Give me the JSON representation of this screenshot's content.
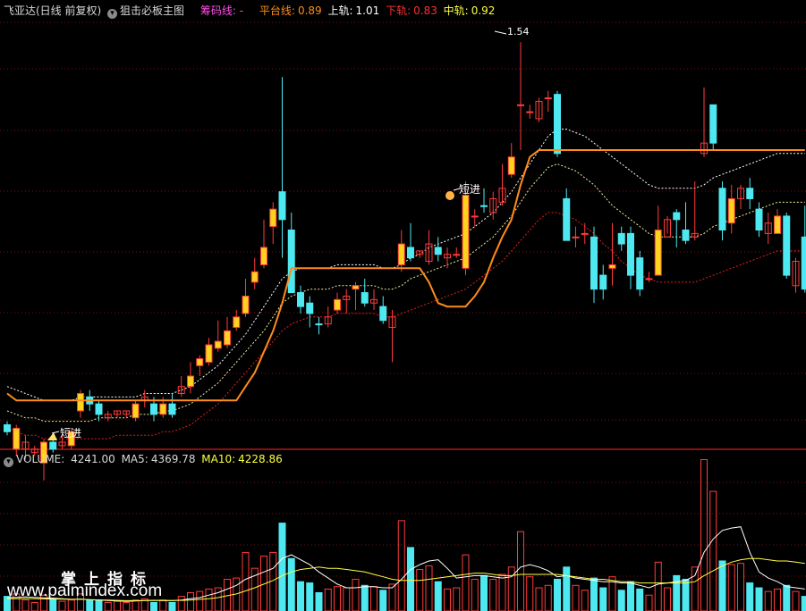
{
  "main_legend": {
    "stock_name": "飞亚达(日线 前复权)",
    "template_name": "狙击必板主图",
    "chip_label": "筹码线: -",
    "platform_label": "平台线:",
    "platform_value": "0.89",
    "upper_label": "上轨:",
    "upper_value": "1.01",
    "lower_label": "下轨:",
    "lower_value": "0.83",
    "middle_label": "中轨:",
    "middle_value": "0.92"
  },
  "volume_legend": {
    "volume_label": "VOLUME:",
    "volume_value": "4241.00",
    "ma5_label": "MA5:",
    "ma5_value": "4369.78",
    "ma10_label": "MA10:",
    "ma10_value": "4228.86"
  },
  "annotations": {
    "signal_1": "短进",
    "signal_2": "短进",
    "high_label": "1.54"
  },
  "watermark": {
    "cn": "掌上指标",
    "url": "www.palmindex.com"
  },
  "colors": {
    "up": "#ff3b3b",
    "down": "#4ee8f0",
    "yellow_body": "#ffd21e",
    "platform": "#ff8c1a",
    "upper": "#ffffff",
    "middle": "#f2ef9a",
    "lower": "#e02020",
    "grid": "#7a1010",
    "ma5": "#ffffff",
    "ma10": "#ffff40"
  },
  "chart_data": {
    "type": "candlestick",
    "price_range": [
      0.36,
      1.58
    ],
    "candles": [
      [
        0.41,
        0.39,
        0.42,
        0.38,
        "d"
      ],
      [
        0.4,
        0.34,
        0.41,
        0.32,
        "y"
      ],
      [
        0.34,
        0.36,
        0.38,
        0.31,
        "u"
      ],
      [
        0.33,
        0.34,
        0.35,
        0.32,
        "u"
      ],
      [
        0.3,
        0.36,
        0.37,
        0.25,
        "y"
      ],
      [
        0.36,
        0.34,
        0.37,
        0.33,
        "d"
      ],
      [
        0.35,
        0.36,
        0.38,
        0.34,
        "u"
      ],
      [
        0.35,
        0.39,
        0.4,
        0.34,
        "y"
      ],
      [
        0.45,
        0.5,
        0.51,
        0.43,
        "y"
      ],
      [
        0.49,
        0.47,
        0.51,
        0.45,
        "d"
      ],
      [
        0.47,
        0.44,
        0.48,
        0.42,
        "d"
      ],
      [
        0.43,
        0.44,
        0.45,
        0.42,
        "u"
      ],
      [
        0.44,
        0.45,
        0.45,
        0.43,
        "u"
      ],
      [
        0.45,
        0.44,
        0.45,
        0.43,
        "u"
      ],
      [
        0.43,
        0.47,
        0.48,
        0.42,
        "y"
      ],
      [
        0.48,
        0.49,
        0.51,
        0.46,
        "u"
      ],
      [
        0.47,
        0.44,
        0.49,
        0.42,
        "d"
      ],
      [
        0.44,
        0.47,
        0.49,
        0.43,
        "y"
      ],
      [
        0.47,
        0.44,
        0.5,
        0.43,
        "d"
      ],
      [
        0.5,
        0.52,
        0.55,
        0.49,
        "u"
      ],
      [
        0.52,
        0.55,
        0.59,
        0.5,
        "y"
      ],
      [
        0.58,
        0.6,
        0.61,
        0.55,
        "y"
      ],
      [
        0.59,
        0.64,
        0.66,
        0.58,
        "y"
      ],
      [
        0.63,
        0.65,
        0.71,
        0.62,
        "y"
      ],
      [
        0.64,
        0.68,
        0.72,
        0.63,
        "y"
      ],
      [
        0.69,
        0.72,
        0.74,
        0.68,
        "y"
      ],
      [
        0.73,
        0.78,
        0.83,
        0.72,
        "y"
      ],
      [
        0.82,
        0.85,
        0.89,
        0.8,
        "y"
      ],
      [
        0.87,
        0.92,
        1.0,
        0.86,
        "y"
      ],
      [
        0.98,
        1.03,
        1.05,
        0.93,
        "y"
      ],
      [
        1.08,
        1.0,
        1.41,
        0.89,
        "d"
      ],
      [
        0.97,
        0.79,
        1.02,
        0.79,
        "d"
      ],
      [
        0.79,
        0.75,
        0.81,
        0.73,
        "d"
      ],
      [
        0.76,
        0.73,
        0.78,
        0.69,
        "d"
      ],
      [
        0.7,
        0.7,
        0.72,
        0.67,
        "d"
      ],
      [
        0.72,
        0.7,
        0.75,
        0.69,
        "u"
      ],
      [
        0.74,
        0.77,
        0.79,
        0.73,
        "y"
      ],
      [
        0.77,
        0.78,
        0.8,
        0.73,
        "u"
      ],
      [
        0.8,
        0.81,
        0.82,
        0.74,
        "y"
      ],
      [
        0.79,
        0.76,
        0.83,
        0.75,
        "d"
      ],
      [
        0.76,
        0.77,
        0.8,
        0.74,
        "u"
      ],
      [
        0.75,
        0.71,
        0.78,
        0.7,
        "d"
      ],
      [
        0.69,
        0.72,
        0.74,
        0.59,
        "u"
      ],
      [
        0.87,
        0.93,
        0.97,
        0.85,
        "y"
      ],
      [
        0.92,
        0.89,
        0.99,
        0.88,
        "d"
      ],
      [
        0.9,
        0.91,
        0.91,
        0.89,
        "u"
      ],
      [
        0.88,
        0.93,
        0.97,
        0.87,
        "u"
      ],
      [
        0.92,
        0.9,
        0.95,
        0.88,
        "d"
      ],
      [
        0.89,
        0.9,
        0.92,
        0.86,
        "u"
      ],
      [
        0.9,
        0.9,
        0.92,
        0.89,
        "u"
      ],
      [
        0.86,
        1.07,
        1.11,
        0.84,
        "y"
      ],
      [
        1.01,
        1.01,
        1.03,
        0.98,
        "u"
      ],
      [
        1.04,
        1.04,
        1.09,
        1.02,
        "d"
      ],
      [
        1.02,
        1.06,
        1.08,
        1.0,
        "u"
      ],
      [
        1.05,
        1.09,
        1.16,
        1.04,
        "u"
      ],
      [
        1.13,
        1.18,
        1.22,
        1.12,
        "y"
      ],
      [
        1.33,
        1.33,
        1.51,
        1.2,
        "u"
      ],
      [
        1.31,
        1.31,
        1.33,
        1.29,
        "u"
      ],
      [
        1.29,
        1.34,
        1.35,
        1.28,
        "u"
      ],
      [
        1.35,
        1.35,
        1.37,
        1.31,
        "u"
      ],
      [
        1.36,
        1.19,
        1.37,
        1.18,
        "d"
      ],
      [
        1.06,
        0.94,
        1.09,
        0.94,
        "d"
      ],
      [
        0.95,
        0.95,
        0.98,
        0.92,
        "u"
      ],
      [
        0.96,
        0.96,
        0.99,
        0.93,
        "u"
      ],
      [
        0.95,
        0.8,
        0.98,
        0.76,
        "d"
      ],
      [
        0.8,
        0.84,
        0.87,
        0.77,
        "d"
      ],
      [
        0.86,
        0.87,
        0.99,
        0.81,
        "y"
      ],
      [
        0.93,
        0.96,
        0.98,
        0.91,
        "d"
      ],
      [
        0.96,
        0.84,
        0.98,
        0.8,
        "d"
      ],
      [
        0.89,
        0.8,
        0.91,
        0.78,
        "d"
      ],
      [
        0.83,
        0.83,
        0.85,
        0.82,
        "u"
      ],
      [
        0.84,
        0.97,
        1.04,
        0.84,
        "y"
      ],
      [
        0.95,
        1.0,
        1.01,
        0.96,
        "u"
      ],
      [
        1.02,
        1.0,
        1.03,
        0.92,
        "d"
      ],
      [
        0.97,
        0.94,
        1.05,
        0.93,
        "d"
      ],
      [
        0.95,
        0.96,
        1.11,
        0.94,
        "u"
      ],
      [
        1.19,
        1.22,
        1.38,
        1.18,
        "u"
      ],
      [
        1.33,
        1.22,
        1.33,
        1.2,
        "d"
      ],
      [
        1.09,
        0.97,
        1.11,
        0.94,
        "d"
      ],
      [
        0.99,
        1.06,
        1.1,
        0.96,
        "y"
      ],
      [
        1.06,
        1.09,
        1.1,
        1.03,
        "u"
      ],
      [
        1.09,
        1.06,
        1.12,
        1.03,
        "d"
      ],
      [
        1.03,
        0.97,
        1.05,
        0.95,
        "d"
      ],
      [
        0.96,
        0.99,
        1.02,
        0.93,
        "u"
      ],
      [
        1.01,
        0.96,
        1.03,
        0.96,
        "y"
      ],
      [
        1.01,
        0.84,
        1.02,
        0.83,
        "d"
      ],
      [
        0.88,
        0.81,
        0.89,
        0.79,
        "u"
      ],
      [
        0.95,
        0.8,
        1.04,
        0.79,
        "d"
      ]
    ],
    "platform": [
      0.5,
      0.48,
      0.48,
      0.48,
      0.48,
      0.48,
      0.48,
      0.48,
      0.48,
      0.48,
      0.48,
      0.48,
      0.48,
      0.48,
      0.48,
      0.48,
      0.48,
      0.48,
      0.48,
      0.48,
      0.48,
      0.48,
      0.48,
      0.48,
      0.48,
      0.48,
      0.52,
      0.56,
      0.62,
      0.68,
      0.76,
      0.86,
      0.86,
      0.86,
      0.86,
      0.86,
      0.86,
      0.86,
      0.86,
      0.86,
      0.86,
      0.86,
      0.86,
      0.86,
      0.86,
      0.86,
      0.82,
      0.76,
      0.75,
      0.75,
      0.75,
      0.78,
      0.82,
      0.89,
      0.95,
      1.0,
      1.1,
      1.18,
      1.2,
      1.2,
      1.2,
      1.2,
      1.2,
      1.2,
      1.2,
      1.2,
      1.2,
      1.2,
      1.2,
      1.2,
      1.2,
      1.2,
      1.2,
      1.2,
      1.2,
      1.2,
      1.2,
      1.2,
      1.2,
      1.2,
      1.2,
      1.2,
      1.2,
      1.2,
      1.2,
      1.2,
      1.2,
      1.2
    ],
    "upper": [
      0.52,
      0.51,
      0.5,
      0.49,
      0.48,
      0.48,
      0.48,
      0.48,
      0.49,
      0.49,
      0.49,
      0.49,
      0.49,
      0.49,
      0.49,
      0.5,
      0.5,
      0.5,
      0.5,
      0.51,
      0.52,
      0.54,
      0.56,
      0.58,
      0.61,
      0.64,
      0.67,
      0.71,
      0.75,
      0.79,
      0.83,
      0.85,
      0.86,
      0.86,
      0.86,
      0.86,
      0.87,
      0.87,
      0.87,
      0.87,
      0.87,
      0.86,
      0.86,
      0.87,
      0.89,
      0.9,
      0.92,
      0.93,
      0.94,
      0.95,
      0.96,
      0.98,
      1.0,
      1.02,
      1.05,
      1.08,
      1.12,
      1.16,
      1.2,
      1.24,
      1.26,
      1.26,
      1.25,
      1.24,
      1.22,
      1.2,
      1.18,
      1.16,
      1.14,
      1.12,
      1.1,
      1.09,
      1.09,
      1.09,
      1.09,
      1.09,
      1.1,
      1.12,
      1.13,
      1.14,
      1.15,
      1.16,
      1.17,
      1.18,
      1.19,
      1.19,
      1.19,
      1.19
    ],
    "middle": [
      0.45,
      0.44,
      0.43,
      0.43,
      0.42,
      0.42,
      0.42,
      0.42,
      0.42,
      0.42,
      0.43,
      0.43,
      0.43,
      0.43,
      0.44,
      0.44,
      0.44,
      0.45,
      0.45,
      0.46,
      0.47,
      0.49,
      0.51,
      0.53,
      0.56,
      0.59,
      0.62,
      0.65,
      0.68,
      0.72,
      0.76,
      0.78,
      0.79,
      0.8,
      0.8,
      0.8,
      0.81,
      0.81,
      0.81,
      0.81,
      0.81,
      0.8,
      0.8,
      0.81,
      0.83,
      0.84,
      0.85,
      0.86,
      0.87,
      0.88,
      0.89,
      0.91,
      0.93,
      0.95,
      0.98,
      1.01,
      1.05,
      1.09,
      1.12,
      1.15,
      1.16,
      1.15,
      1.14,
      1.12,
      1.1,
      1.07,
      1.04,
      1.02,
      1.0,
      0.98,
      0.96,
      0.95,
      0.95,
      0.95,
      0.95,
      0.95,
      0.96,
      0.98,
      0.99,
      1.0,
      1.01,
      1.02,
      1.03,
      1.04,
      1.05,
      1.05,
      1.05,
      1.05
    ],
    "lower": [
      0.4,
      0.39,
      0.38,
      0.38,
      0.37,
      0.37,
      0.37,
      0.37,
      0.37,
      0.37,
      0.37,
      0.37,
      0.38,
      0.38,
      0.38,
      0.38,
      0.38,
      0.39,
      0.39,
      0.4,
      0.41,
      0.43,
      0.45,
      0.47,
      0.5,
      0.53,
      0.56,
      0.59,
      0.62,
      0.65,
      0.68,
      0.7,
      0.71,
      0.72,
      0.72,
      0.72,
      0.73,
      0.73,
      0.73,
      0.73,
      0.73,
      0.72,
      0.72,
      0.73,
      0.74,
      0.75,
      0.76,
      0.77,
      0.78,
      0.79,
      0.8,
      0.82,
      0.84,
      0.86,
      0.88,
      0.91,
      0.94,
      0.97,
      1.0,
      1.02,
      1.02,
      1.01,
      1.0,
      0.98,
      0.96,
      0.93,
      0.91,
      0.88,
      0.86,
      0.84,
      0.83,
      0.82,
      0.82,
      0.82,
      0.82,
      0.82,
      0.83,
      0.84,
      0.85,
      0.86,
      0.87,
      0.88,
      0.89,
      0.9,
      0.91,
      0.91,
      0.91,
      0.91
    ],
    "volume_max": 12000,
    "volume": [
      [
        1200,
        "d"
      ],
      [
        1400,
        "u"
      ],
      [
        900,
        "u"
      ],
      [
        700,
        "u"
      ],
      [
        1300,
        "u"
      ],
      [
        1000,
        "d"
      ],
      [
        800,
        "u"
      ],
      [
        900,
        "u"
      ],
      [
        1400,
        "u"
      ],
      [
        900,
        "d"
      ],
      [
        900,
        "d"
      ],
      [
        700,
        "u"
      ],
      [
        800,
        "u"
      ],
      [
        700,
        "u"
      ],
      [
        900,
        "u"
      ],
      [
        1000,
        "u"
      ],
      [
        700,
        "d"
      ],
      [
        900,
        "u"
      ],
      [
        700,
        "d"
      ],
      [
        1200,
        "u"
      ],
      [
        1500,
        "u"
      ],
      [
        1600,
        "u"
      ],
      [
        1800,
        "u"
      ],
      [
        1900,
        "u"
      ],
      [
        2600,
        "u"
      ],
      [
        2700,
        "u"
      ],
      [
        4800,
        "u"
      ],
      [
        3500,
        "u"
      ],
      [
        4500,
        "u"
      ],
      [
        4800,
        "u"
      ],
      [
        7200,
        "d"
      ],
      [
        4300,
        "d"
      ],
      [
        2400,
        "d"
      ],
      [
        2300,
        "d"
      ],
      [
        1500,
        "d"
      ],
      [
        1800,
        "u"
      ],
      [
        2000,
        "u"
      ],
      [
        1900,
        "u"
      ],
      [
        2600,
        "u"
      ],
      [
        2100,
        "d"
      ],
      [
        2000,
        "u"
      ],
      [
        1700,
        "d"
      ],
      [
        2200,
        "u"
      ],
      [
        7400,
        "u"
      ],
      [
        5200,
        "d"
      ],
      [
        3400,
        "u"
      ],
      [
        3700,
        "u"
      ],
      [
        2400,
        "d"
      ],
      [
        1800,
        "u"
      ],
      [
        1900,
        "u"
      ],
      [
        4600,
        "u"
      ],
      [
        2600,
        "u"
      ],
      [
        2900,
        "d"
      ],
      [
        2600,
        "u"
      ],
      [
        3000,
        "u"
      ],
      [
        3600,
        "u"
      ],
      [
        6500,
        "u"
      ],
      [
        2800,
        "u"
      ],
      [
        1900,
        "u"
      ],
      [
        2100,
        "u"
      ],
      [
        2600,
        "d"
      ],
      [
        3600,
        "d"
      ],
      [
        2100,
        "u"
      ],
      [
        1700,
        "u"
      ],
      [
        2700,
        "d"
      ],
      [
        1900,
        "d"
      ],
      [
        2800,
        "u"
      ],
      [
        1700,
        "d"
      ],
      [
        2400,
        "d"
      ],
      [
        1800,
        "d"
      ],
      [
        1300,
        "u"
      ],
      [
        4000,
        "u"
      ],
      [
        1900,
        "u"
      ],
      [
        2900,
        "d"
      ],
      [
        2600,
        "d"
      ],
      [
        3600,
        "u"
      ],
      [
        12400,
        "u"
      ],
      [
        9800,
        "u"
      ],
      [
        4100,
        "d"
      ],
      [
        3800,
        "u"
      ],
      [
        3900,
        "u"
      ],
      [
        2300,
        "d"
      ],
      [
        1900,
        "d"
      ],
      [
        1600,
        "u"
      ],
      [
        1800,
        "u"
      ],
      [
        2100,
        "d"
      ],
      [
        1600,
        "u"
      ],
      [
        1200,
        "d"
      ]
    ],
    "ma5": [
      1100,
      1120,
      1150,
      1120,
      1080,
      1050,
      1000,
      950,
      980,
      920,
      900,
      860,
      820,
      780,
      820,
      860,
      880,
      860,
      850,
      900,
      1000,
      1100,
      1300,
      1500,
      1800,
      2100,
      2600,
      2900,
      3200,
      3500,
      4300,
      4600,
      4200,
      3800,
      3200,
      2700,
      2200,
      1900,
      1900,
      2000,
      2000,
      1900,
      1900,
      2600,
      3400,
      3800,
      4100,
      4200,
      3500,
      2700,
      2800,
      2900,
      2900,
      2800,
      2700,
      2800,
      3600,
      3800,
      3600,
      3300,
      2800,
      2900,
      2700,
      2600,
      2500,
      2400,
      2400,
      2300,
      2300,
      2100,
      1900,
      2200,
      2300,
      2400,
      2500,
      2900,
      4800,
      5900,
      6600,
      6800,
      6900,
      4800,
      3200,
      2700,
      2400,
      2000,
      1900,
      1800
    ],
    "ma10": [
      1000,
      1000,
      1010,
      1000,
      990,
      980,
      970,
      960,
      950,
      930,
      910,
      890,
      870,
      850,
      850,
      860,
      860,
      860,
      860,
      870,
      900,
      950,
      1000,
      1100,
      1250,
      1400,
      1650,
      1900,
      2200,
      2500,
      2900,
      3200,
      3400,
      3500,
      3600,
      3500,
      3500,
      3400,
      3300,
      3200,
      3000,
      2800,
      2600,
      2500,
      2500,
      2500,
      2600,
      2700,
      2800,
      2900,
      3000,
      3100,
      3100,
      3000,
      2900,
      2900,
      3000,
      3000,
      3000,
      3000,
      3000,
      2900,
      2800,
      2700,
      2600,
      2600,
      2500,
      2400,
      2400,
      2300,
      2300,
      2300,
      2300,
      2300,
      2300,
      2400,
      2900,
      3300,
      3700,
      4000,
      4200,
      4300,
      4300,
      4200,
      4100,
      4100,
      4000,
      3900
    ]
  }
}
